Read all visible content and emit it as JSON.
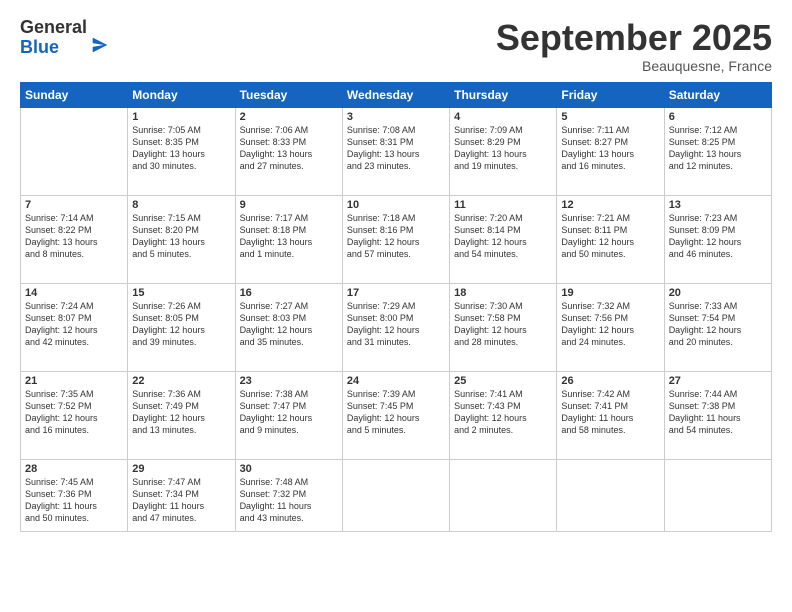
{
  "logo": {
    "general": "General",
    "blue": "Blue"
  },
  "title": "September 2025",
  "location": "Beauquesne, France",
  "days_header": [
    "Sunday",
    "Monday",
    "Tuesday",
    "Wednesday",
    "Thursday",
    "Friday",
    "Saturday"
  ],
  "weeks": [
    [
      {
        "day": "",
        "info": ""
      },
      {
        "day": "1",
        "info": "Sunrise: 7:05 AM\nSunset: 8:35 PM\nDaylight: 13 hours\nand 30 minutes."
      },
      {
        "day": "2",
        "info": "Sunrise: 7:06 AM\nSunset: 8:33 PM\nDaylight: 13 hours\nand 27 minutes."
      },
      {
        "day": "3",
        "info": "Sunrise: 7:08 AM\nSunset: 8:31 PM\nDaylight: 13 hours\nand 23 minutes."
      },
      {
        "day": "4",
        "info": "Sunrise: 7:09 AM\nSunset: 8:29 PM\nDaylight: 13 hours\nand 19 minutes."
      },
      {
        "day": "5",
        "info": "Sunrise: 7:11 AM\nSunset: 8:27 PM\nDaylight: 13 hours\nand 16 minutes."
      },
      {
        "day": "6",
        "info": "Sunrise: 7:12 AM\nSunset: 8:25 PM\nDaylight: 13 hours\nand 12 minutes."
      }
    ],
    [
      {
        "day": "7",
        "info": "Sunrise: 7:14 AM\nSunset: 8:22 PM\nDaylight: 13 hours\nand 8 minutes."
      },
      {
        "day": "8",
        "info": "Sunrise: 7:15 AM\nSunset: 8:20 PM\nDaylight: 13 hours\nand 5 minutes."
      },
      {
        "day": "9",
        "info": "Sunrise: 7:17 AM\nSunset: 8:18 PM\nDaylight: 13 hours\nand 1 minute."
      },
      {
        "day": "10",
        "info": "Sunrise: 7:18 AM\nSunset: 8:16 PM\nDaylight: 12 hours\nand 57 minutes."
      },
      {
        "day": "11",
        "info": "Sunrise: 7:20 AM\nSunset: 8:14 PM\nDaylight: 12 hours\nand 54 minutes."
      },
      {
        "day": "12",
        "info": "Sunrise: 7:21 AM\nSunset: 8:11 PM\nDaylight: 12 hours\nand 50 minutes."
      },
      {
        "day": "13",
        "info": "Sunrise: 7:23 AM\nSunset: 8:09 PM\nDaylight: 12 hours\nand 46 minutes."
      }
    ],
    [
      {
        "day": "14",
        "info": "Sunrise: 7:24 AM\nSunset: 8:07 PM\nDaylight: 12 hours\nand 42 minutes."
      },
      {
        "day": "15",
        "info": "Sunrise: 7:26 AM\nSunset: 8:05 PM\nDaylight: 12 hours\nand 39 minutes."
      },
      {
        "day": "16",
        "info": "Sunrise: 7:27 AM\nSunset: 8:03 PM\nDaylight: 12 hours\nand 35 minutes."
      },
      {
        "day": "17",
        "info": "Sunrise: 7:29 AM\nSunset: 8:00 PM\nDaylight: 12 hours\nand 31 minutes."
      },
      {
        "day": "18",
        "info": "Sunrise: 7:30 AM\nSunset: 7:58 PM\nDaylight: 12 hours\nand 28 minutes."
      },
      {
        "day": "19",
        "info": "Sunrise: 7:32 AM\nSunset: 7:56 PM\nDaylight: 12 hours\nand 24 minutes."
      },
      {
        "day": "20",
        "info": "Sunrise: 7:33 AM\nSunset: 7:54 PM\nDaylight: 12 hours\nand 20 minutes."
      }
    ],
    [
      {
        "day": "21",
        "info": "Sunrise: 7:35 AM\nSunset: 7:52 PM\nDaylight: 12 hours\nand 16 minutes."
      },
      {
        "day": "22",
        "info": "Sunrise: 7:36 AM\nSunset: 7:49 PM\nDaylight: 12 hours\nand 13 minutes."
      },
      {
        "day": "23",
        "info": "Sunrise: 7:38 AM\nSunset: 7:47 PM\nDaylight: 12 hours\nand 9 minutes."
      },
      {
        "day": "24",
        "info": "Sunrise: 7:39 AM\nSunset: 7:45 PM\nDaylight: 12 hours\nand 5 minutes."
      },
      {
        "day": "25",
        "info": "Sunrise: 7:41 AM\nSunset: 7:43 PM\nDaylight: 12 hours\nand 2 minutes."
      },
      {
        "day": "26",
        "info": "Sunrise: 7:42 AM\nSunset: 7:41 PM\nDaylight: 11 hours\nand 58 minutes."
      },
      {
        "day": "27",
        "info": "Sunrise: 7:44 AM\nSunset: 7:38 PM\nDaylight: 11 hours\nand 54 minutes."
      }
    ],
    [
      {
        "day": "28",
        "info": "Sunrise: 7:45 AM\nSunset: 7:36 PM\nDaylight: 11 hours\nand 50 minutes."
      },
      {
        "day": "29",
        "info": "Sunrise: 7:47 AM\nSunset: 7:34 PM\nDaylight: 11 hours\nand 47 minutes."
      },
      {
        "day": "30",
        "info": "Sunrise: 7:48 AM\nSunset: 7:32 PM\nDaylight: 11 hours\nand 43 minutes."
      },
      {
        "day": "",
        "info": ""
      },
      {
        "day": "",
        "info": ""
      },
      {
        "day": "",
        "info": ""
      },
      {
        "day": "",
        "info": ""
      }
    ]
  ]
}
